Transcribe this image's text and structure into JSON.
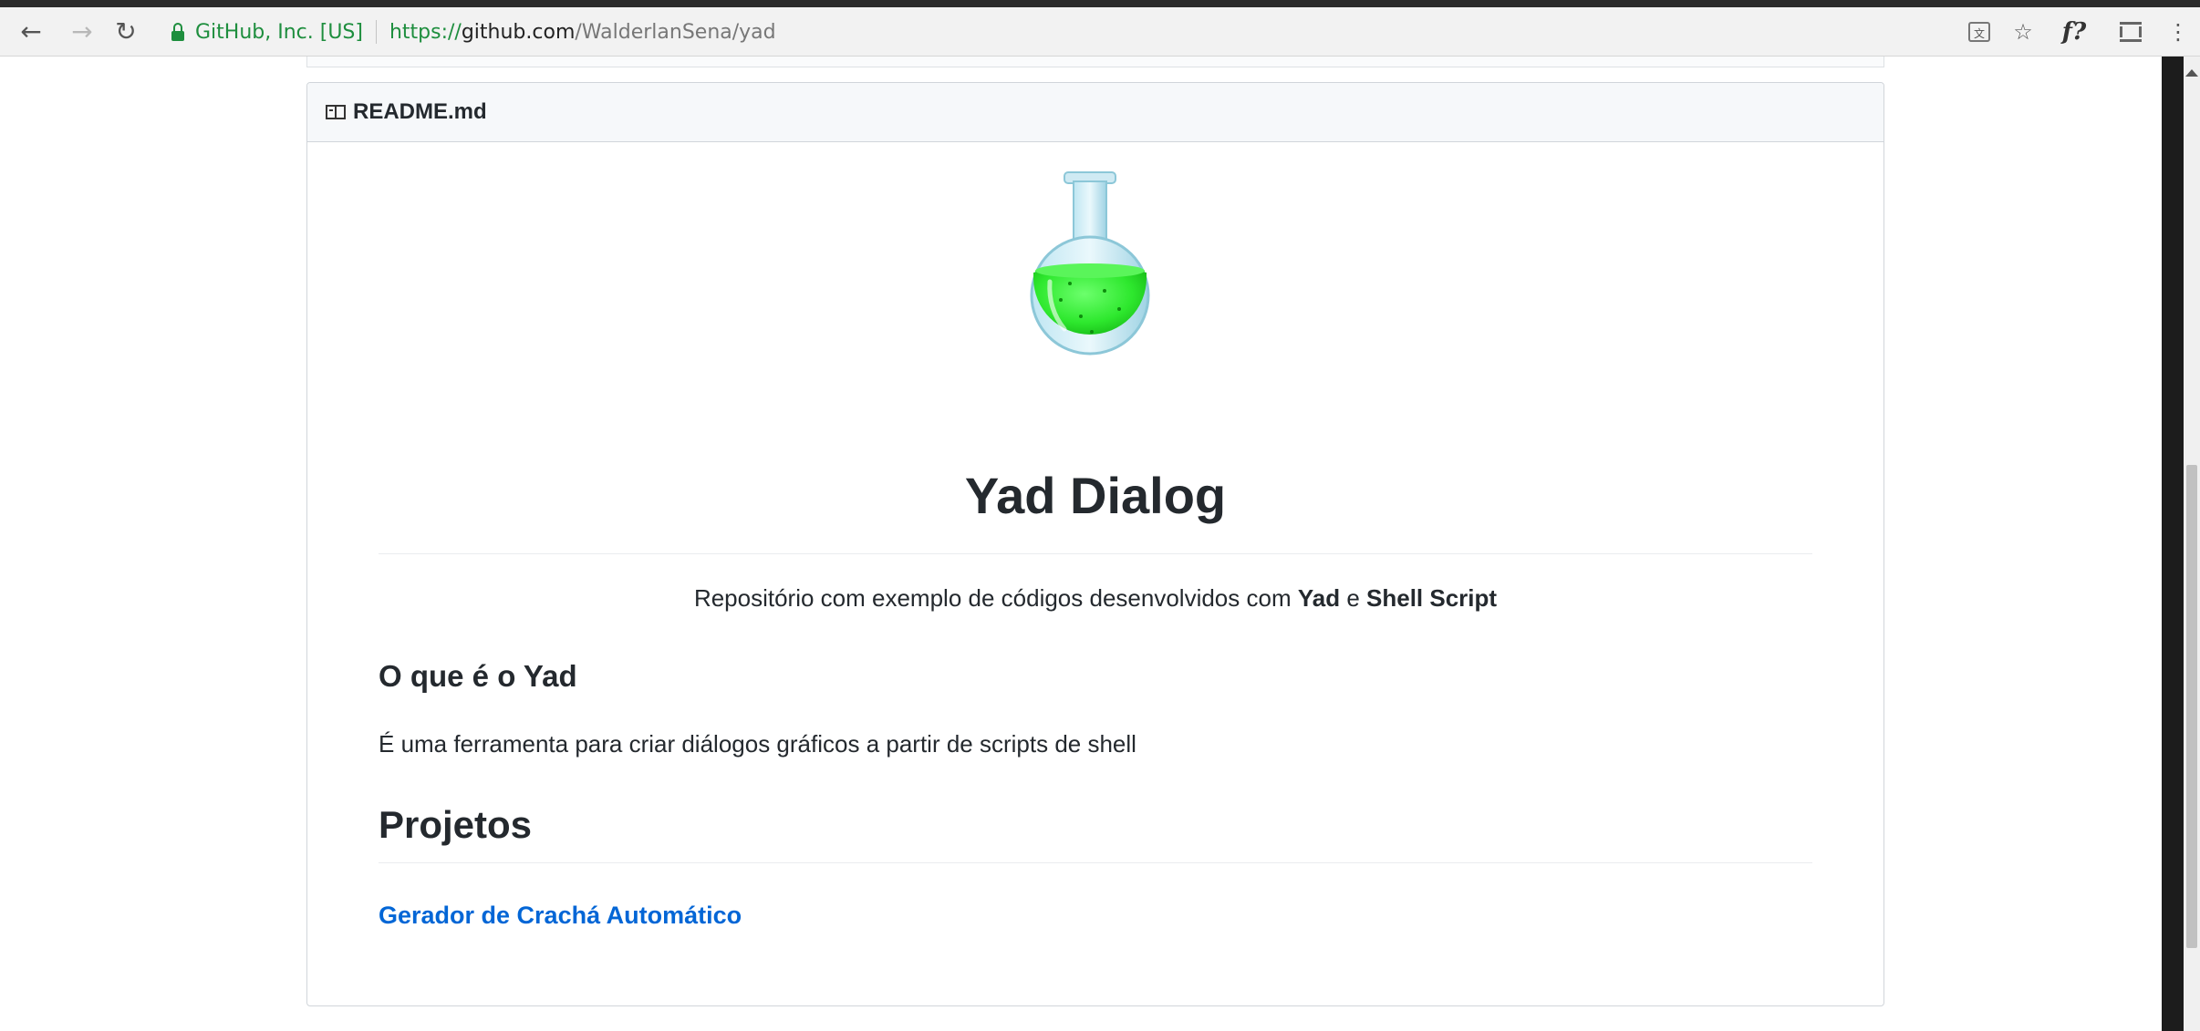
{
  "browser": {
    "secure_label": "GitHub, Inc. [US]",
    "url_scheme": "https://",
    "url_host": "github.com",
    "url_path": "/WalderlanSena/yad",
    "fx_label": "f?"
  },
  "readme": {
    "filename": "README.md",
    "title": "Yad Dialog",
    "subtitle_prefix": "Repositório com exemplo de códigos desenvolvidos com ",
    "subtitle_bold1": "Yad",
    "subtitle_mid": " e ",
    "subtitle_bold2": "Shell Script",
    "section_what": "O que é o Yad",
    "section_what_text": "É uma ferramenta para criar diálogos gráficos a partir de scripts de shell",
    "section_projects": "Projetos",
    "project_link": "Gerador de Crachá Automático"
  },
  "colors": {
    "link": "#0366d6",
    "secure_green": "#1e8e3e",
    "flask_liquid": "#2ee82e"
  }
}
